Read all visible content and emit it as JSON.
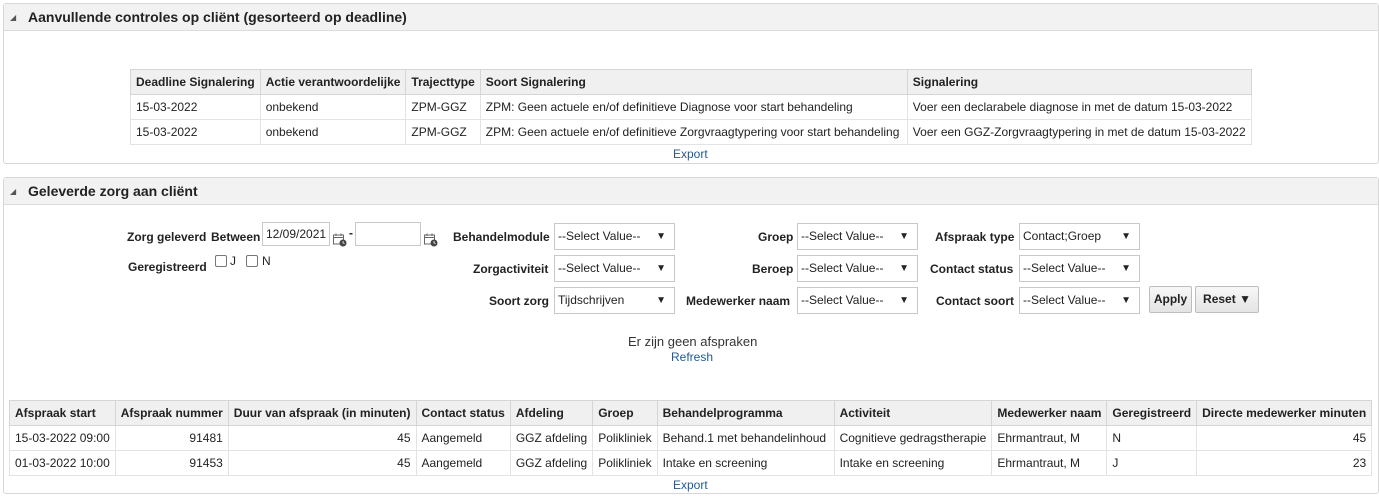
{
  "section1": {
    "title": "Aanvullende controles op cliënt (gesorteerd op deadline)",
    "table": {
      "headers": [
        "Deadline Signalering",
        "Actie verantwoordelijke",
        "Trajecttype",
        "Soort Signalering",
        "Signalering"
      ],
      "rows": [
        [
          "15-03-2022",
          "onbekend",
          "ZPM-GGZ",
          "ZPM: Geen actuele en/of definitieve Diagnose voor start behandeling",
          "Voer een declarabele diagnose in met de datum 15-03-2022"
        ],
        [
          "15-03-2022",
          "onbekend",
          "ZPM-GGZ",
          "ZPM: Geen actuele en/of definitieve Zorgvraagtypering voor start behandeling",
          "Voer een GGZ-Zorgvraagtypering in met de datum 15-03-2022"
        ]
      ]
    },
    "export_label": "Export"
  },
  "section2": {
    "title": "Geleverde zorg aan cliënt",
    "filters": {
      "zorg_geleverd_label": "Zorg geleverd",
      "between_label": "Between",
      "date_from": "12/09/2021",
      "date_separator": "-",
      "date_to": "",
      "geregistreerd_label": "Geregistreerd",
      "check_j": "J",
      "check_n": "N",
      "behandelmodule_label": "Behandelmodule",
      "behandelmodule_value": "--Select Value--",
      "zorgactiviteit_label": "Zorgactiviteit",
      "zorgactiviteit_value": "--Select Value--",
      "soort_zorg_label": "Soort zorg",
      "soort_zorg_value": "Tijdschrijven",
      "groep_label": "Groep",
      "groep_value": "--Select Value--",
      "beroep_label": "Beroep",
      "beroep_value": "--Select Value--",
      "medewerker_label": "Medewerker naam",
      "medewerker_value": "--Select Value--",
      "afspraak_type_label": "Afspraak type",
      "afspraak_type_value": "Contact;Groep",
      "contact_status_label": "Contact status",
      "contact_status_value": "--Select Value--",
      "contact_soort_label": "Contact soort",
      "contact_soort_value": "--Select Value--",
      "apply_label": "Apply",
      "reset_label": "Reset ▼"
    },
    "no_appointments": "Er zijn geen afspraken",
    "refresh_label": "Refresh",
    "table": {
      "headers": [
        "Afspraak start",
        "Afspraak nummer",
        "Duur van afspraak (in minuten)",
        "Contact status",
        "Afdeling",
        "Groep",
        "Behandelprogramma",
        "Activiteit",
        "Medewerker naam",
        "Geregistreerd",
        "Directe medewerker minuten"
      ],
      "rows": [
        [
          "15-03-2022 09:00",
          "91481",
          "45",
          "Aangemeld",
          "GGZ afdeling",
          "Polikliniek",
          "Behand.1 met behandelinhoud",
          "Cognitieve gedragstherapie",
          "Ehrmantraut, M",
          "N",
          "45"
        ],
        [
          "01-03-2022 10:00",
          "91453",
          "45",
          "Aangemeld",
          "GGZ afdeling",
          "Polikliniek",
          "Intake en screening",
          "Intake en screening",
          "Ehrmantraut, M",
          "J",
          "23"
        ]
      ]
    },
    "export_label": "Export"
  }
}
